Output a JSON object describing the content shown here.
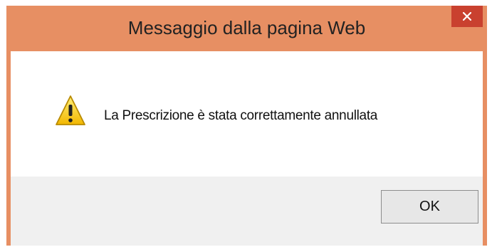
{
  "dialog": {
    "title": "Messaggio dalla pagina Web",
    "close_icon": "close-icon",
    "warning_icon": "warning-icon",
    "message": "La Prescrizione è stata correttamente annullata",
    "ok_label": "OK",
    "colors": {
      "frame": "#e78f63",
      "close_button": "#c9412f",
      "button_area": "#f0f0f0"
    }
  }
}
